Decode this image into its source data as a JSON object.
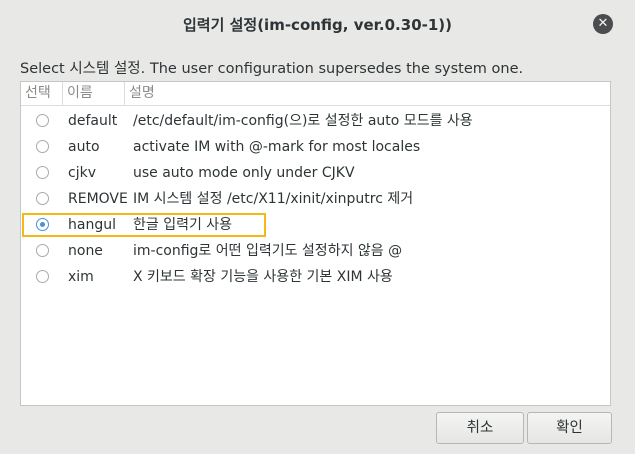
{
  "window": {
    "title": "입력기 설정(im-config, ver.0.30-1))",
    "close_glyph": "✕"
  },
  "description": "Select 시스템 설정. The user configuration supersedes the system one.",
  "table": {
    "columns": [
      "선택",
      "이름",
      "설명"
    ],
    "rows": [
      {
        "name": "default",
        "desc": "/etc/default/im-config(으)로 설정한 auto 모드를 사용",
        "selected": false
      },
      {
        "name": "auto",
        "desc": "activate IM with @-mark for most locales",
        "selected": false
      },
      {
        "name": "cjkv",
        "desc": "use auto mode only under CJKV",
        "selected": false
      },
      {
        "name": "REMOVE",
        "desc": "IM 시스템 설정 /etc/X11/xinit/xinputrc 제거",
        "selected": false
      },
      {
        "name": "hangul",
        "desc": "한글 입력기 사용",
        "selected": true
      },
      {
        "name": "none",
        "desc": "im-config로 어떤 입력기도 설정하지 않음 @",
        "selected": false
      },
      {
        "name": "xim",
        "desc": "X 키보드 확장 기능을 사용한 기본 XIM 사용",
        "selected": false
      }
    ]
  },
  "buttons": {
    "cancel": "취소",
    "ok": "확인"
  },
  "colors": {
    "accent": "#4a90d9",
    "highlight_box": "#f5b818"
  }
}
